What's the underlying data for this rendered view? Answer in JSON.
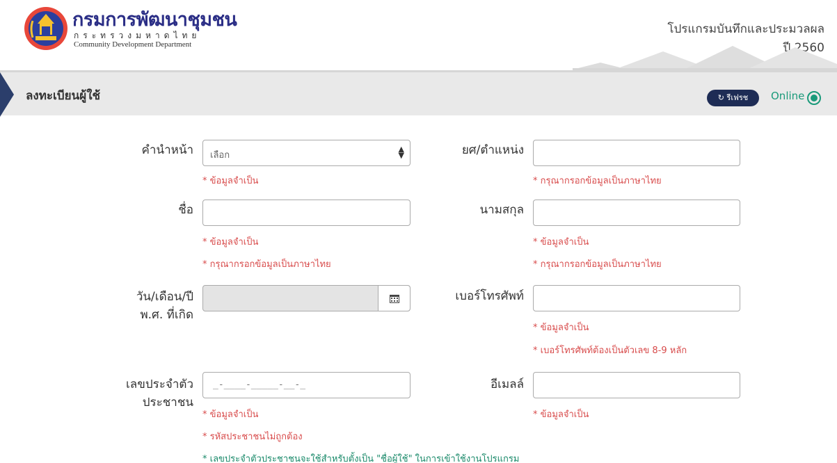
{
  "header": {
    "org_name": "กรมการพัฒนาชุมชน",
    "ministry": "กระทรวงมหาดไทย",
    "org_name_en": "Community Development Department",
    "program_title": "โปรแกรมบันทึกและประมวลผล",
    "program_year": "ปี 2560"
  },
  "title_bar": {
    "title": "ลงทะเบียนผู้ใช้",
    "refresh_label": "↻ รีเฟรช",
    "status_label": "Online"
  },
  "form": {
    "prefix": {
      "label": "คำนำหน้า",
      "value": "เลือก",
      "errors": [
        "* ข้อมูลจำเป็น"
      ]
    },
    "position": {
      "label": "ยศ/ตำแหน่ง",
      "value": "",
      "errors": [
        "* กรุณากรอกข้อมูลเป็นภาษาไทย"
      ]
    },
    "first_name": {
      "label": "ชื่อ",
      "value": "",
      "errors": [
        "* ข้อมูลจำเป็น",
        "* กรุณากรอกข้อมูลเป็นภาษาไทย"
      ]
    },
    "last_name": {
      "label": "นามสกุล",
      "value": "",
      "errors": [
        "* ข้อมูลจำเป็น",
        "* กรุณากรอกข้อมูลเป็นภาษาไทย"
      ]
    },
    "birth_date": {
      "label_line1": "วัน/เดือน/ปี",
      "label_line2": "พ.ศ. ที่เกิด",
      "value": ""
    },
    "phone": {
      "label": "เบอร์โทรศัพท์",
      "value": "",
      "errors": [
        "* ข้อมูลจำเป็น",
        "* เบอร์โทรศัพท์ต้องเป็นตัวเลข 8-9 หลัก"
      ]
    },
    "citizen_id": {
      "label_line1": "เลขประจำตัว",
      "label_line2": "ประชาชน",
      "mask": "_-____-_____-__-_",
      "errors": [
        "* ข้อมูลจำเป็น",
        "* รหัสประชาชนไม่ถูกต้อง"
      ],
      "note": "* เลขประจำตัวประชาชนจะใช้สำหรับตั้งเป็น \"ชื่อผู้ใช้\" ในการเข้าใช้งานโปรแกรม"
    },
    "email": {
      "label": "อีเมลล์",
      "value": "",
      "errors": [
        "* ข้อมูลจำเป็น"
      ]
    }
  },
  "colors": {
    "brand": "#2b2e86",
    "error": "#d84b4b",
    "online": "#1a9a7a",
    "navy": "#1e2c55"
  },
  "icons": [
    "department-seal-logo",
    "houses-illustration",
    "refresh-icon",
    "online-status-icon",
    "select-caret-icon",
    "calendar-icon"
  ]
}
